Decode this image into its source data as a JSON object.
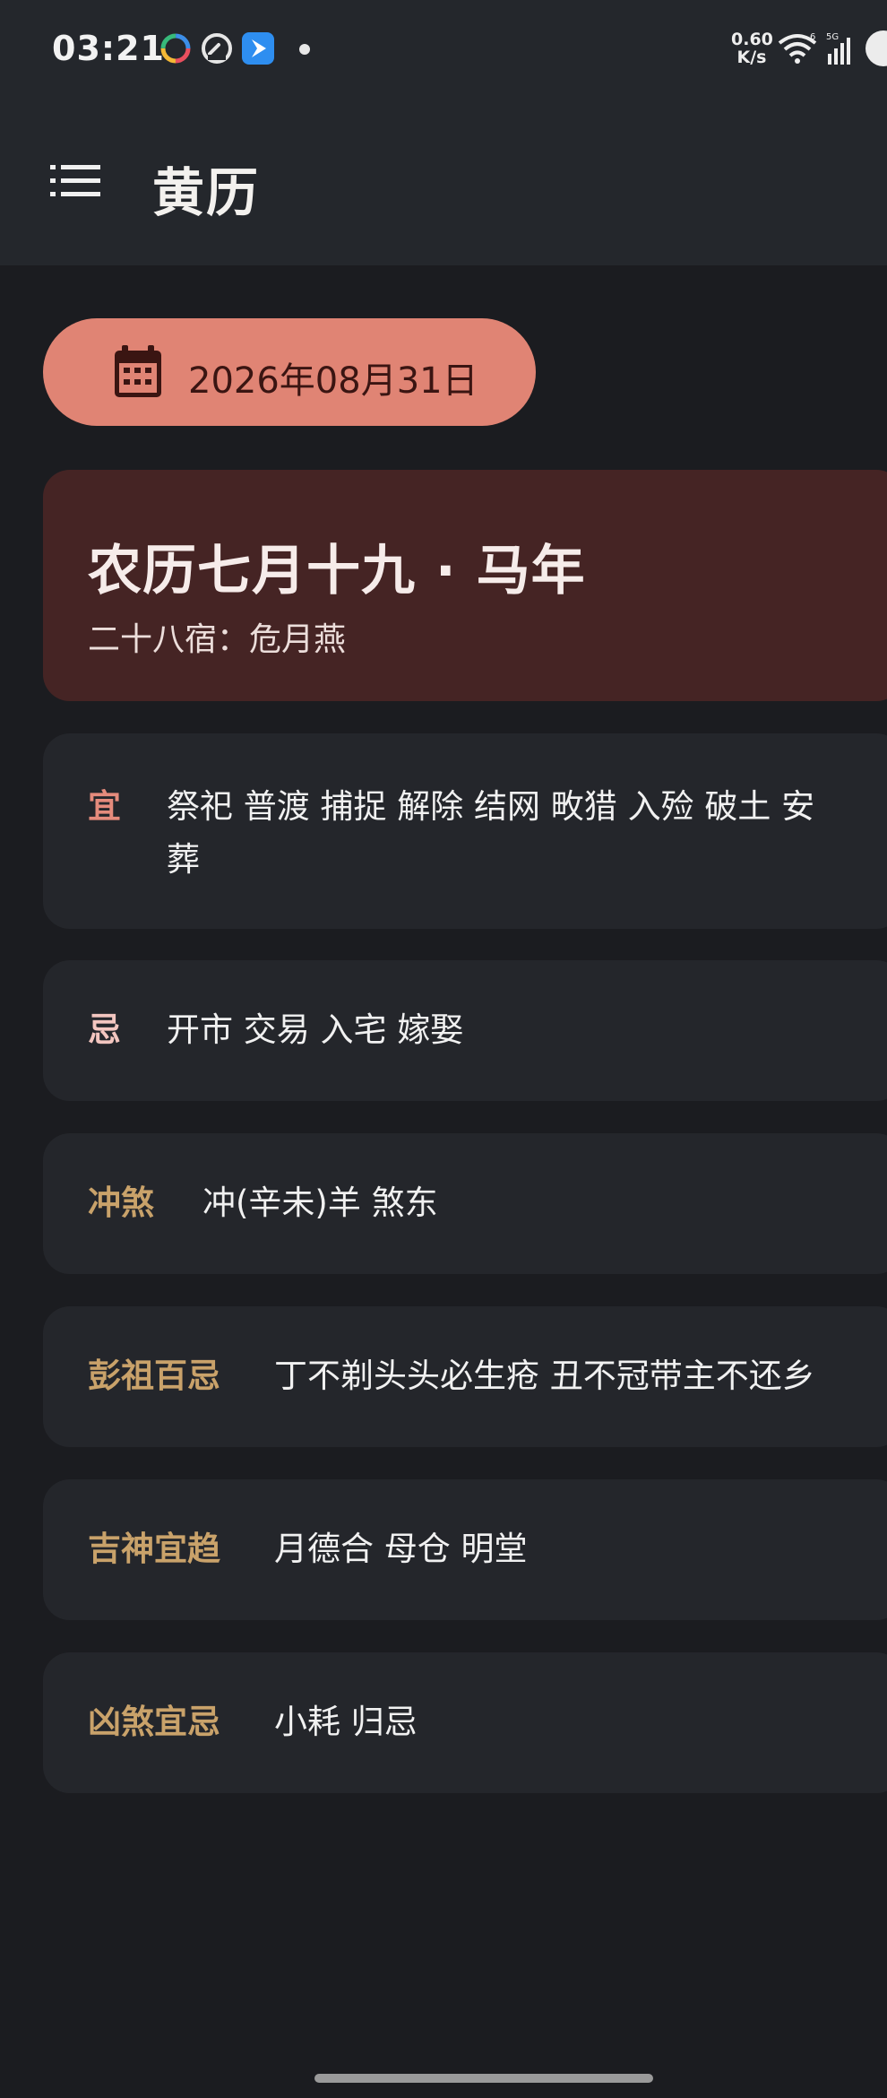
{
  "status_bar": {
    "time": "03:21",
    "net_speed_value": "0.60",
    "net_speed_unit": "K/s",
    "icons": [
      "sync-ring-icon",
      "speedometer-icon",
      "app-notification-icon",
      "wifi-icon",
      "signal-5g-icon",
      "battery-icon"
    ]
  },
  "app_bar": {
    "title": "黄历",
    "menu_icon": "menu-list-icon"
  },
  "date_chip": {
    "icon": "calendar-icon",
    "date": "2026年08月31日"
  },
  "lunar": {
    "title": "农历七月十九 · 马年",
    "subtitle": "二十八宿：危月燕"
  },
  "sections": {
    "yi": {
      "label": "宜",
      "line1": "祭祀 普渡 捕捉 解除 结网 畋猎 入殓 破土 安",
      "line2": "葬"
    },
    "ji": {
      "label": "忌",
      "value": "开市 交易 入宅 嫁娶"
    },
    "chongsha": {
      "label": "冲煞",
      "value": "冲(辛未)羊 煞东"
    },
    "pengzu": {
      "label": "彭祖百忌",
      "value": "丁不剃头头必生疮 丑不冠带主不还乡"
    },
    "jishen": {
      "label": "吉神宜趋",
      "value": "月德合 母仓 明堂"
    },
    "xiongsha": {
      "label": "凶煞宜忌",
      "value": "小耗 归忌"
    }
  },
  "colors": {
    "background": "#1b1c20",
    "bar": "#24272c",
    "chip": "#e08474",
    "lunar_card": "#452424",
    "card": "#24262b",
    "accent_red": "#e58b7c",
    "accent_gold": "#c9a26a"
  }
}
